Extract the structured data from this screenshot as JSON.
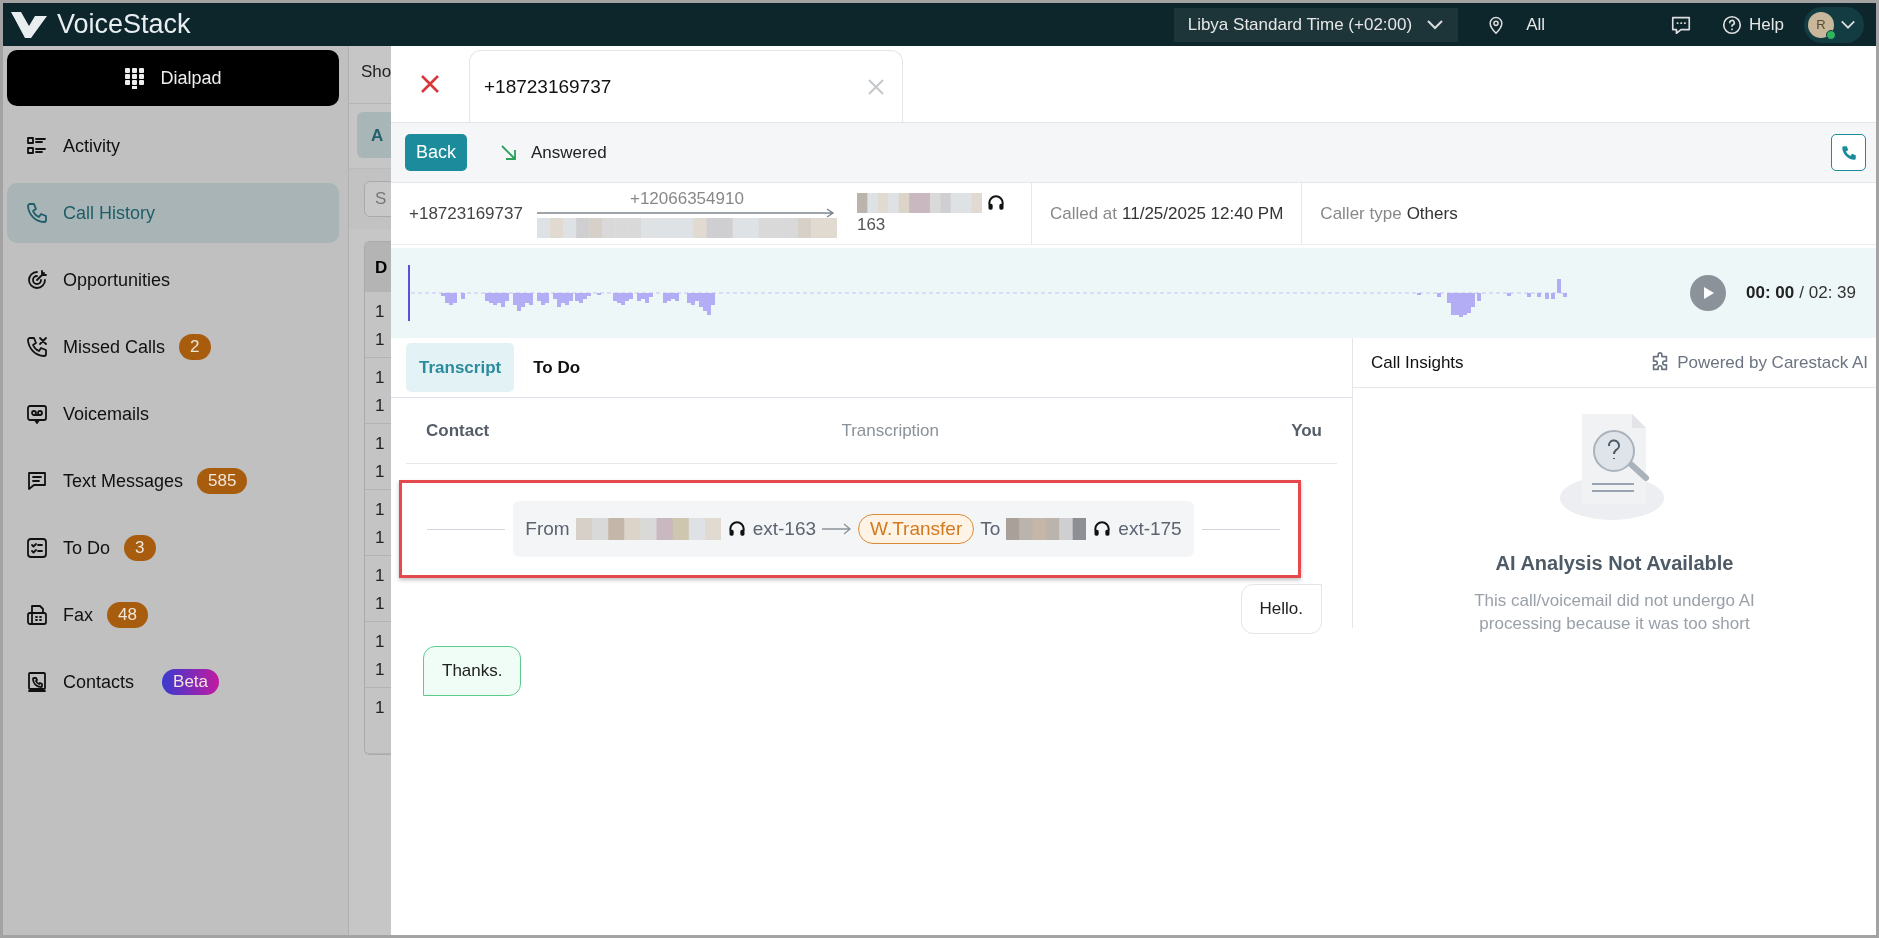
{
  "app": {
    "name": "VoiceStack"
  },
  "top_bar": {
    "timezone": "Libya Standard Time (+02:00)",
    "location": "All",
    "help": "Help",
    "avatar_initial": "R"
  },
  "sidebar": {
    "dialpad": "Dialpad",
    "items": [
      {
        "label": "Activity",
        "selected": false
      },
      {
        "label": "Call History",
        "selected": true
      },
      {
        "label": "Opportunities",
        "selected": false
      },
      {
        "label": "Missed Calls",
        "selected": false,
        "badge": {
          "text": "2",
          "kind": "count"
        }
      },
      {
        "label": "Voicemails",
        "selected": false
      },
      {
        "label": "Text Messages",
        "selected": false,
        "badge": {
          "text": "585",
          "kind": "count"
        }
      },
      {
        "label": "To Do",
        "selected": false,
        "badge": {
          "text": "3",
          "kind": "count"
        }
      },
      {
        "label": "Fax",
        "selected": false,
        "badge": {
          "text": "48",
          "kind": "count"
        }
      },
      {
        "label": "Contacts",
        "selected": false,
        "badge": {
          "text": "Beta",
          "kind": "beta"
        }
      }
    ]
  },
  "background_list": {
    "heading": "Sho",
    "tab": "A",
    "search_placeholder": "S",
    "column_header": "D",
    "rows": [
      [
        "1",
        "1"
      ],
      [
        "1",
        "1"
      ],
      [
        "1",
        "1"
      ],
      [
        "1",
        "1"
      ],
      [
        "1",
        "1"
      ],
      [
        "1",
        "1"
      ],
      [
        "1"
      ]
    ]
  },
  "call_panel": {
    "tabs": [
      {
        "label": "+18723169737",
        "selected": true
      }
    ],
    "back": "Back",
    "status": "Answered",
    "from_number": "+18723169737",
    "via_number": "+12066354910",
    "agent_ext": "163",
    "called_at_label": "Called at",
    "called_at": "11/25/2025 12:40 PM",
    "caller_type_label": "Caller type",
    "caller_type": "Others",
    "time_current": "00: 00",
    "time_total": "/ 02: 39"
  },
  "transcript": {
    "tabs": [
      {
        "label": "Transcript",
        "selected": true
      },
      {
        "label": "To Do",
        "selected": false
      }
    ],
    "columns": [
      "Contact",
      "Transcription",
      "You"
    ],
    "events": [
      {
        "kind": "transfer",
        "highlighted": true,
        "from_label": "From",
        "from_ext": "ext-163",
        "transfer_type": "W.Transfer",
        "to_label": "To",
        "to_ext": "ext-175"
      }
    ],
    "messages": [
      {
        "kind": "outgoing",
        "text": "Hello."
      },
      {
        "kind": "incoming",
        "text": "Thanks."
      }
    ]
  },
  "insights": {
    "title": "Call Insights",
    "powered_by": "Powered by Carestack AI",
    "empty_title": "AI Analysis Not Available",
    "empty_text": "This call/voicemail did not undergo AI processing because it was too short"
  }
}
